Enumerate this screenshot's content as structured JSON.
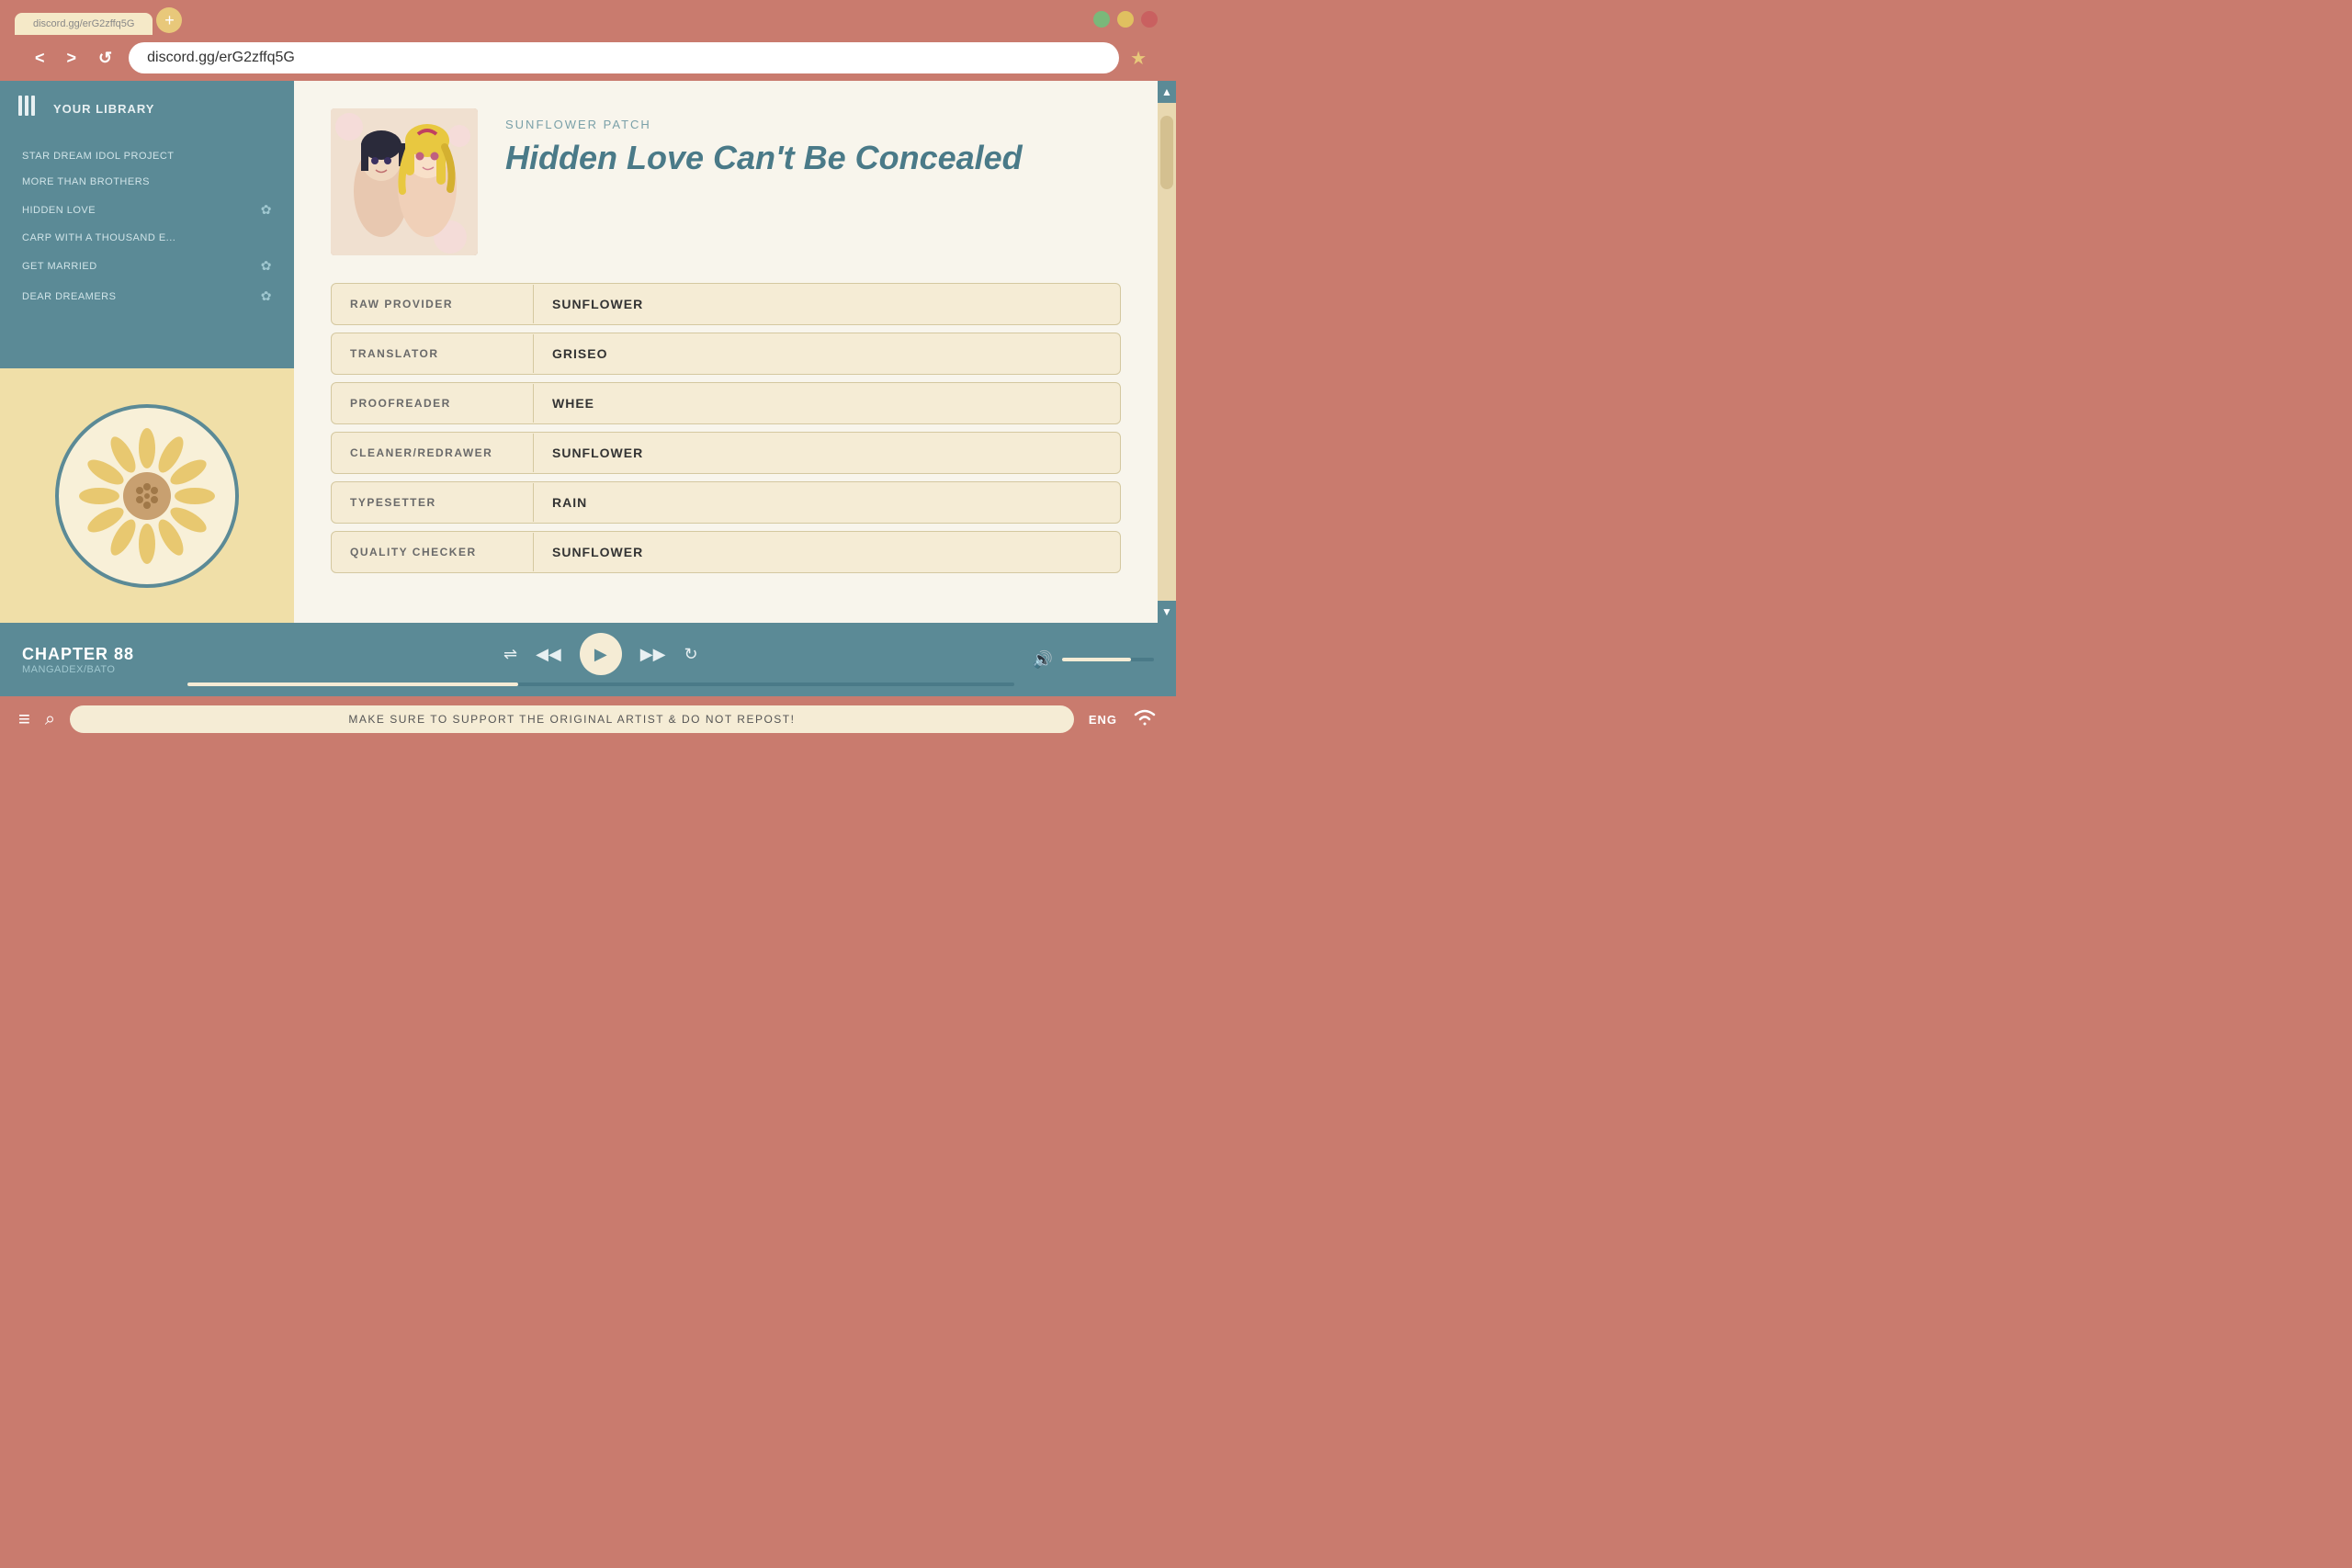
{
  "browser": {
    "tab_label": "discord.gg/erG2zffq5G",
    "address": "discord.gg/erG2zffq5G",
    "tab_add_icon": "+",
    "back_icon": "<",
    "forward_icon": ">",
    "refresh_icon": "↺",
    "bookmark_icon": "★"
  },
  "sidebar": {
    "title": "YOUR LIBRARY",
    "library_icon": "|||",
    "items": [
      {
        "label": "STAR DREAM IDOL PROJECT",
        "has_icon": false
      },
      {
        "label": "MORE THAN BROTHERS",
        "has_icon": false
      },
      {
        "label": "HIDDEN LOVE",
        "has_icon": true
      },
      {
        "label": "CARP WITH A THOUSAND E...",
        "has_icon": false
      },
      {
        "label": "GET MARRIED",
        "has_icon": true
      },
      {
        "label": "DEAR DREAMERS",
        "has_icon": true
      }
    ]
  },
  "manga": {
    "publisher": "SUNFLOWER PATCH",
    "title": "Hidden Love Can't Be Concealed"
  },
  "credits": [
    {
      "label": "RAW PROVIDER",
      "value": "SUNFLOWER"
    },
    {
      "label": "TRANSLATOR",
      "value": "GRISEO"
    },
    {
      "label": "PROOFREADER",
      "value": "WHEE"
    },
    {
      "label": "CLEANER/REDRAWER",
      "value": "SUNFLOWER"
    },
    {
      "label": "TYPESETTER",
      "value": "RAIN"
    },
    {
      "label": "QUALITY CHECKER",
      "value": "SUNFLOWER"
    }
  ],
  "player": {
    "chapter_label": "CHAPTER 88",
    "source_label": "MANGADEX/BATO",
    "shuffle_icon": "⇌",
    "prev_icon": "◀◀",
    "play_icon": "▶",
    "next_icon": "▶▶",
    "repeat_icon": "↻",
    "volume_icon": "🔊"
  },
  "statusbar": {
    "menu_icon": "≡",
    "search_icon": "⌕",
    "message": "MAKE SURE TO SUPPORT THE ORIGINAL ARTIST & DO NOT REPOST!",
    "lang": "ENG",
    "wifi_icon": "📶"
  },
  "scrollbar": {
    "up_icon": "▲",
    "down_icon": "▼"
  }
}
